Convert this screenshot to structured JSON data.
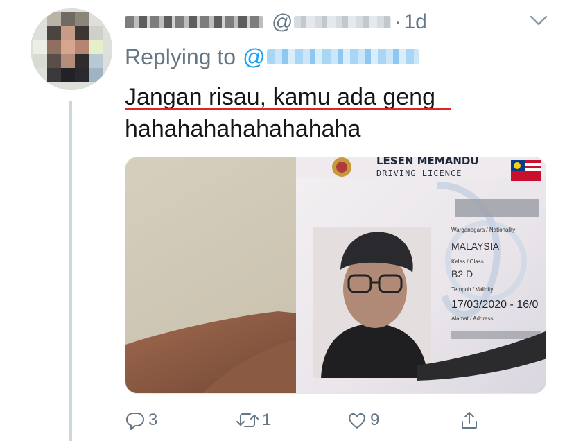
{
  "tweet": {
    "handle_prefix": "@",
    "separator": "·",
    "time": "1d",
    "replying_to_label": "Replying to",
    "reply_at": "@",
    "text_line1": "Jangan risau, kamu ada geng",
    "text_line2": "hahahahahahahahaha"
  },
  "card": {
    "title": "LESEN MEMANDU",
    "subtitle": "DRIVING LICENCE",
    "nationality_label": "Warganegara / Nationality",
    "nationality": "MALAYSIA",
    "class_label": "Kelas / Class",
    "class": "B2 D",
    "validity_label": "Tempoh / Validity",
    "validity": "17/03/2020 - 16/0",
    "address_label": "Alamat / Address"
  },
  "actions": {
    "reply_count": "3",
    "retweet_count": "1",
    "like_count": "9"
  },
  "colors": {
    "accent": "#1da1f2",
    "muted": "#657786",
    "underline": "#e0242a"
  },
  "icons": [
    "chevron-down-icon",
    "reply-icon",
    "retweet-icon",
    "like-icon",
    "share-icon"
  ]
}
